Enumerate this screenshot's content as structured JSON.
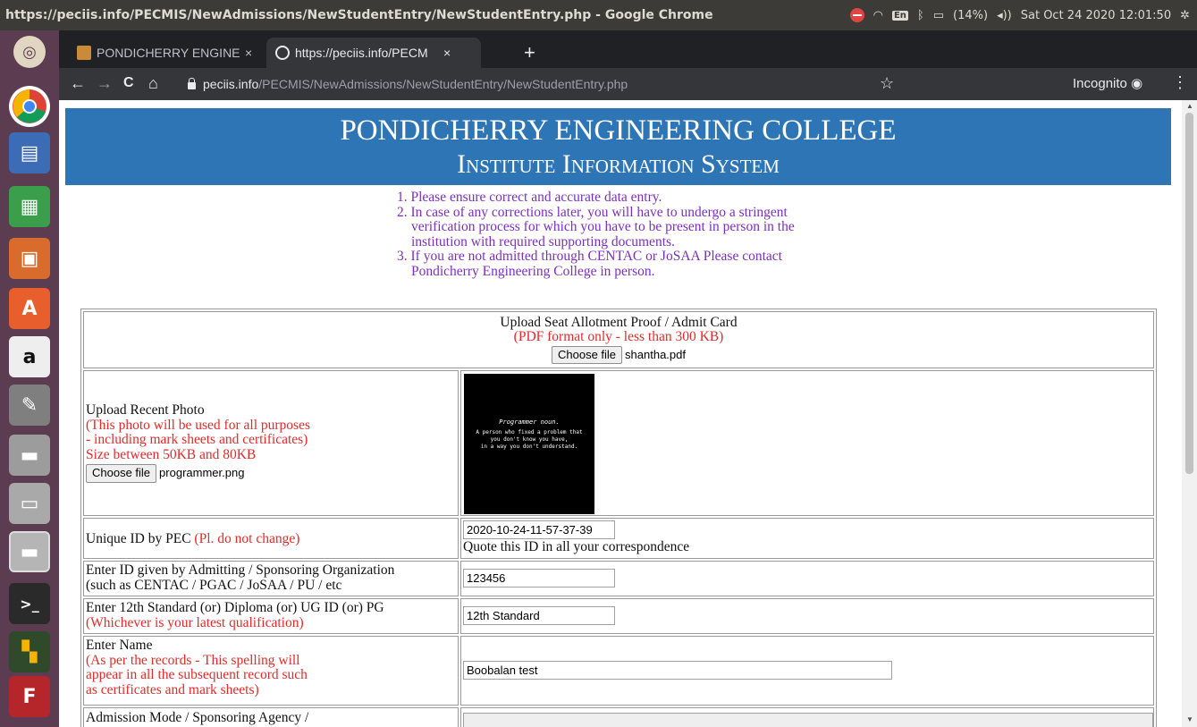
{
  "window": {
    "title": "https://peciis.info/PECMIS/NewAdmissions/NewStudentEntry/NewStudentEntry.php - Google Chrome"
  },
  "tray": {
    "lang": "En",
    "battery": "(14%)",
    "clock": "Sat Oct 24 2020 12:01:50"
  },
  "launcher": {
    "icons": [
      "ubuntu-dash-icon",
      "chrome-icon",
      "writer-icon",
      "calc-icon",
      "impress-icon",
      "software-center-icon",
      "amazon-icon",
      "system-settings-icon",
      "drive-icon",
      "files-icon",
      "drive-icon",
      "terminal-icon",
      "system-monitor-icon",
      "filezilla-icon"
    ]
  },
  "tabs": [
    {
      "label": "PONDICHERRY ENGINEER",
      "close": "×"
    },
    {
      "label": "https://peciis.info/PECM",
      "close": "×"
    }
  ],
  "newtab": "+",
  "toolbar": {
    "back": "←",
    "forward": "→",
    "reload": "C",
    "home": "⌂",
    "url_host": "peciis.info",
    "url_path": "/PECMIS/NewAdmissions/NewStudentEntry/NewStudentEntry.php",
    "star": "☆",
    "incognito": "Incognito",
    "menu": "⋮"
  },
  "header": {
    "title": "PONDICHERRY ENGINEERING COLLEGE",
    "subtitle": "Institute Information System"
  },
  "notes": [
    "1. Please ensure correct and accurate data entry.",
    "2. In case of any corrections later, you will have to undergo a stringent verification process for which you have to be present in person in the institution with required supporting documents.",
    "3. If you are not admitted through CENTAC or JoSAA Please contact Pondicherry Engineering College in person."
  ],
  "form": {
    "seat": {
      "title": "Upload Seat Allotment Proof / Admit Card",
      "note": "(PDF format only - less than 300 KB)",
      "button": "Choose file",
      "file": "shantha.pdf"
    },
    "photo": {
      "title": "Upload Recent Photo",
      "note1": "(This photo will be used for all purposes",
      "note2": "- including mark sheets and certificates)",
      "note3": "Size between 50KB and 80KB",
      "button": "Choose file",
      "file": "programmer.png",
      "img_line1": "Programmer",
      "img_line1b": "noun.",
      "img_line2": "A person who fixed a problem that",
      "img_line3": "you don't know you have,",
      "img_line4": "in a way you don't understand."
    },
    "unique": {
      "label": "Unique ID by PEC",
      "label_red": "(Pl. do not change)",
      "value": "2020-10-24-11-57-37-39",
      "hint": "Quote this ID in all your correspondence"
    },
    "sponsor": {
      "label1": "Enter ID given by Admitting / Sponsoring Organization",
      "label2": "(such as CENTAC / PGAC / JoSAA / PU / etc",
      "value": "123456"
    },
    "qual": {
      "label1": "Enter 12th Standard (or) Diploma (or) UG ID (or) PG",
      "label2": "(Whichever is your latest qualification)",
      "value": "12th Standard"
    },
    "name": {
      "label": "Enter Name",
      "note1": "(As per the records - This spelling will",
      "note2": "appear in all the subsequent record such",
      "note3": "as certificates and mark sheets)",
      "value": "Boobalan test"
    },
    "admission": {
      "label": "Admission Mode / Sponsoring Agency /"
    }
  },
  "scroll": {
    "up": "▲",
    "down": "▼"
  }
}
